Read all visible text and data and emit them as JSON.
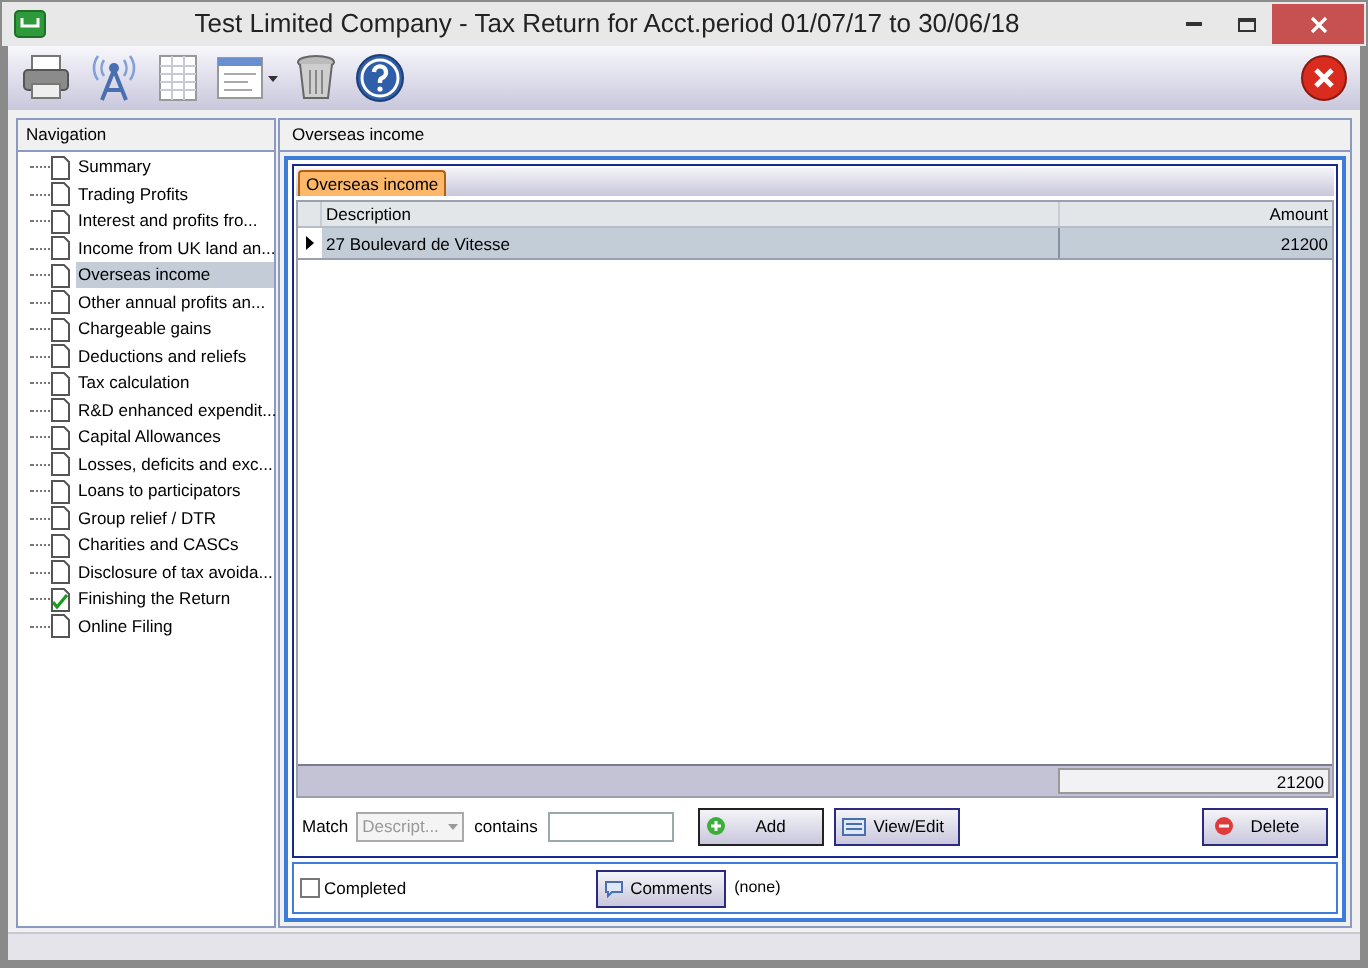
{
  "window": {
    "title": "Test Limited Company - Tax Return for Acct.period 01/07/17 to 30/06/18"
  },
  "navigation": {
    "title": "Navigation",
    "items": [
      {
        "label": "Summary",
        "selected": false,
        "checked": false
      },
      {
        "label": "Trading Profits",
        "selected": false,
        "checked": false
      },
      {
        "label": "Interest and profits fro...",
        "selected": false,
        "checked": false
      },
      {
        "label": "Income from UK land an...",
        "selected": false,
        "checked": false
      },
      {
        "label": "Overseas income",
        "selected": true,
        "checked": false
      },
      {
        "label": "Other annual profits an...",
        "selected": false,
        "checked": false
      },
      {
        "label": "Chargeable gains",
        "selected": false,
        "checked": false
      },
      {
        "label": "Deductions and reliefs",
        "selected": false,
        "checked": false
      },
      {
        "label": "Tax calculation",
        "selected": false,
        "checked": false
      },
      {
        "label": "R&D enhanced expendit...",
        "selected": false,
        "checked": false
      },
      {
        "label": "Capital Allowances",
        "selected": false,
        "checked": false
      },
      {
        "label": "Losses, deficits and exc...",
        "selected": false,
        "checked": false
      },
      {
        "label": "Loans to participators",
        "selected": false,
        "checked": false
      },
      {
        "label": "Group relief / DTR",
        "selected": false,
        "checked": false
      },
      {
        "label": "Charities and CASCs",
        "selected": false,
        "checked": false
      },
      {
        "label": "Disclosure of tax avoida...",
        "selected": false,
        "checked": false
      },
      {
        "label": "Finishing the Return",
        "selected": false,
        "checked": true
      },
      {
        "label": "Online Filing",
        "selected": false,
        "checked": false
      }
    ]
  },
  "page_title": "Overseas income",
  "tabs": [
    {
      "label": "Overseas income",
      "selected": true
    }
  ],
  "table": {
    "columns": [
      "Description",
      "Amount"
    ],
    "rows": [
      {
        "cells": [
          "27 Boulevard de Vitesse",
          "21200"
        ],
        "selected": true
      }
    ],
    "total": "21200"
  },
  "filter": {
    "match_label": "Match",
    "field": "Descript...",
    "contains_label": "contains"
  },
  "buttons": {
    "add": "Add",
    "view_edit": "View/Edit",
    "delete": "Delete"
  },
  "completed": {
    "label": "Completed",
    "checked": false
  },
  "comments": {
    "button": "Comments",
    "value": "(none)"
  }
}
